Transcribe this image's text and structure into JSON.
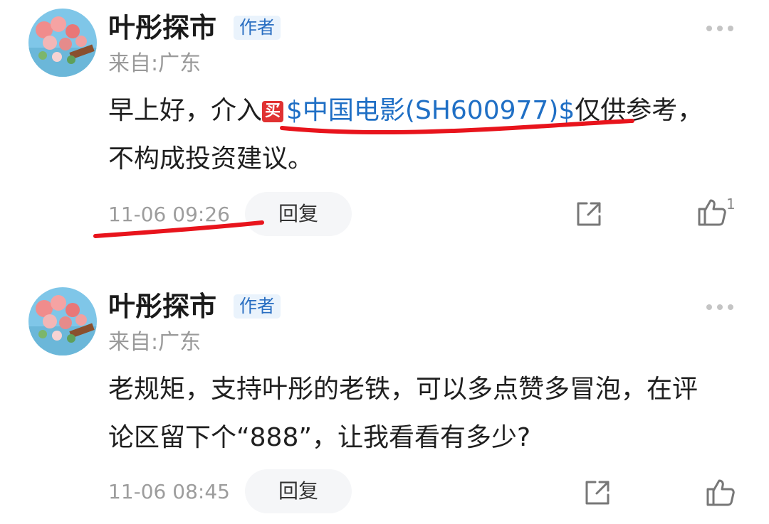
{
  "comments": [
    {
      "author": "叶彤探市",
      "badge": "作者",
      "location": "来自:广东",
      "text_prefix": "早上好，介入",
      "buy_tag": "买",
      "stock_link": "$中国电影(SH600977)$",
      "text_suffix": "仅供参考，不构成投资建议。",
      "time": "11-06 09:26",
      "reply_label": "回复",
      "like_count": "1"
    },
    {
      "author": "叶彤探市",
      "badge": "作者",
      "location": "来自:广东",
      "text": "老规矩，支持叶彤的老铁，可以多点赞多冒泡，在评论区留下个“888”，让我看看有多少?",
      "time": "11-06 08:45",
      "reply_label": "回复"
    }
  ],
  "colors": {
    "link": "#1f6fc5",
    "badge_text": "#2a6fc2",
    "badge_bg": "#eaf3fc",
    "annotation_red": "#e8141c",
    "muted": "#9d9d9d"
  },
  "icons": [
    "avatar",
    "more-dots-icon",
    "buy-tag-icon",
    "share-icon",
    "thumbs-up-icon"
  ]
}
